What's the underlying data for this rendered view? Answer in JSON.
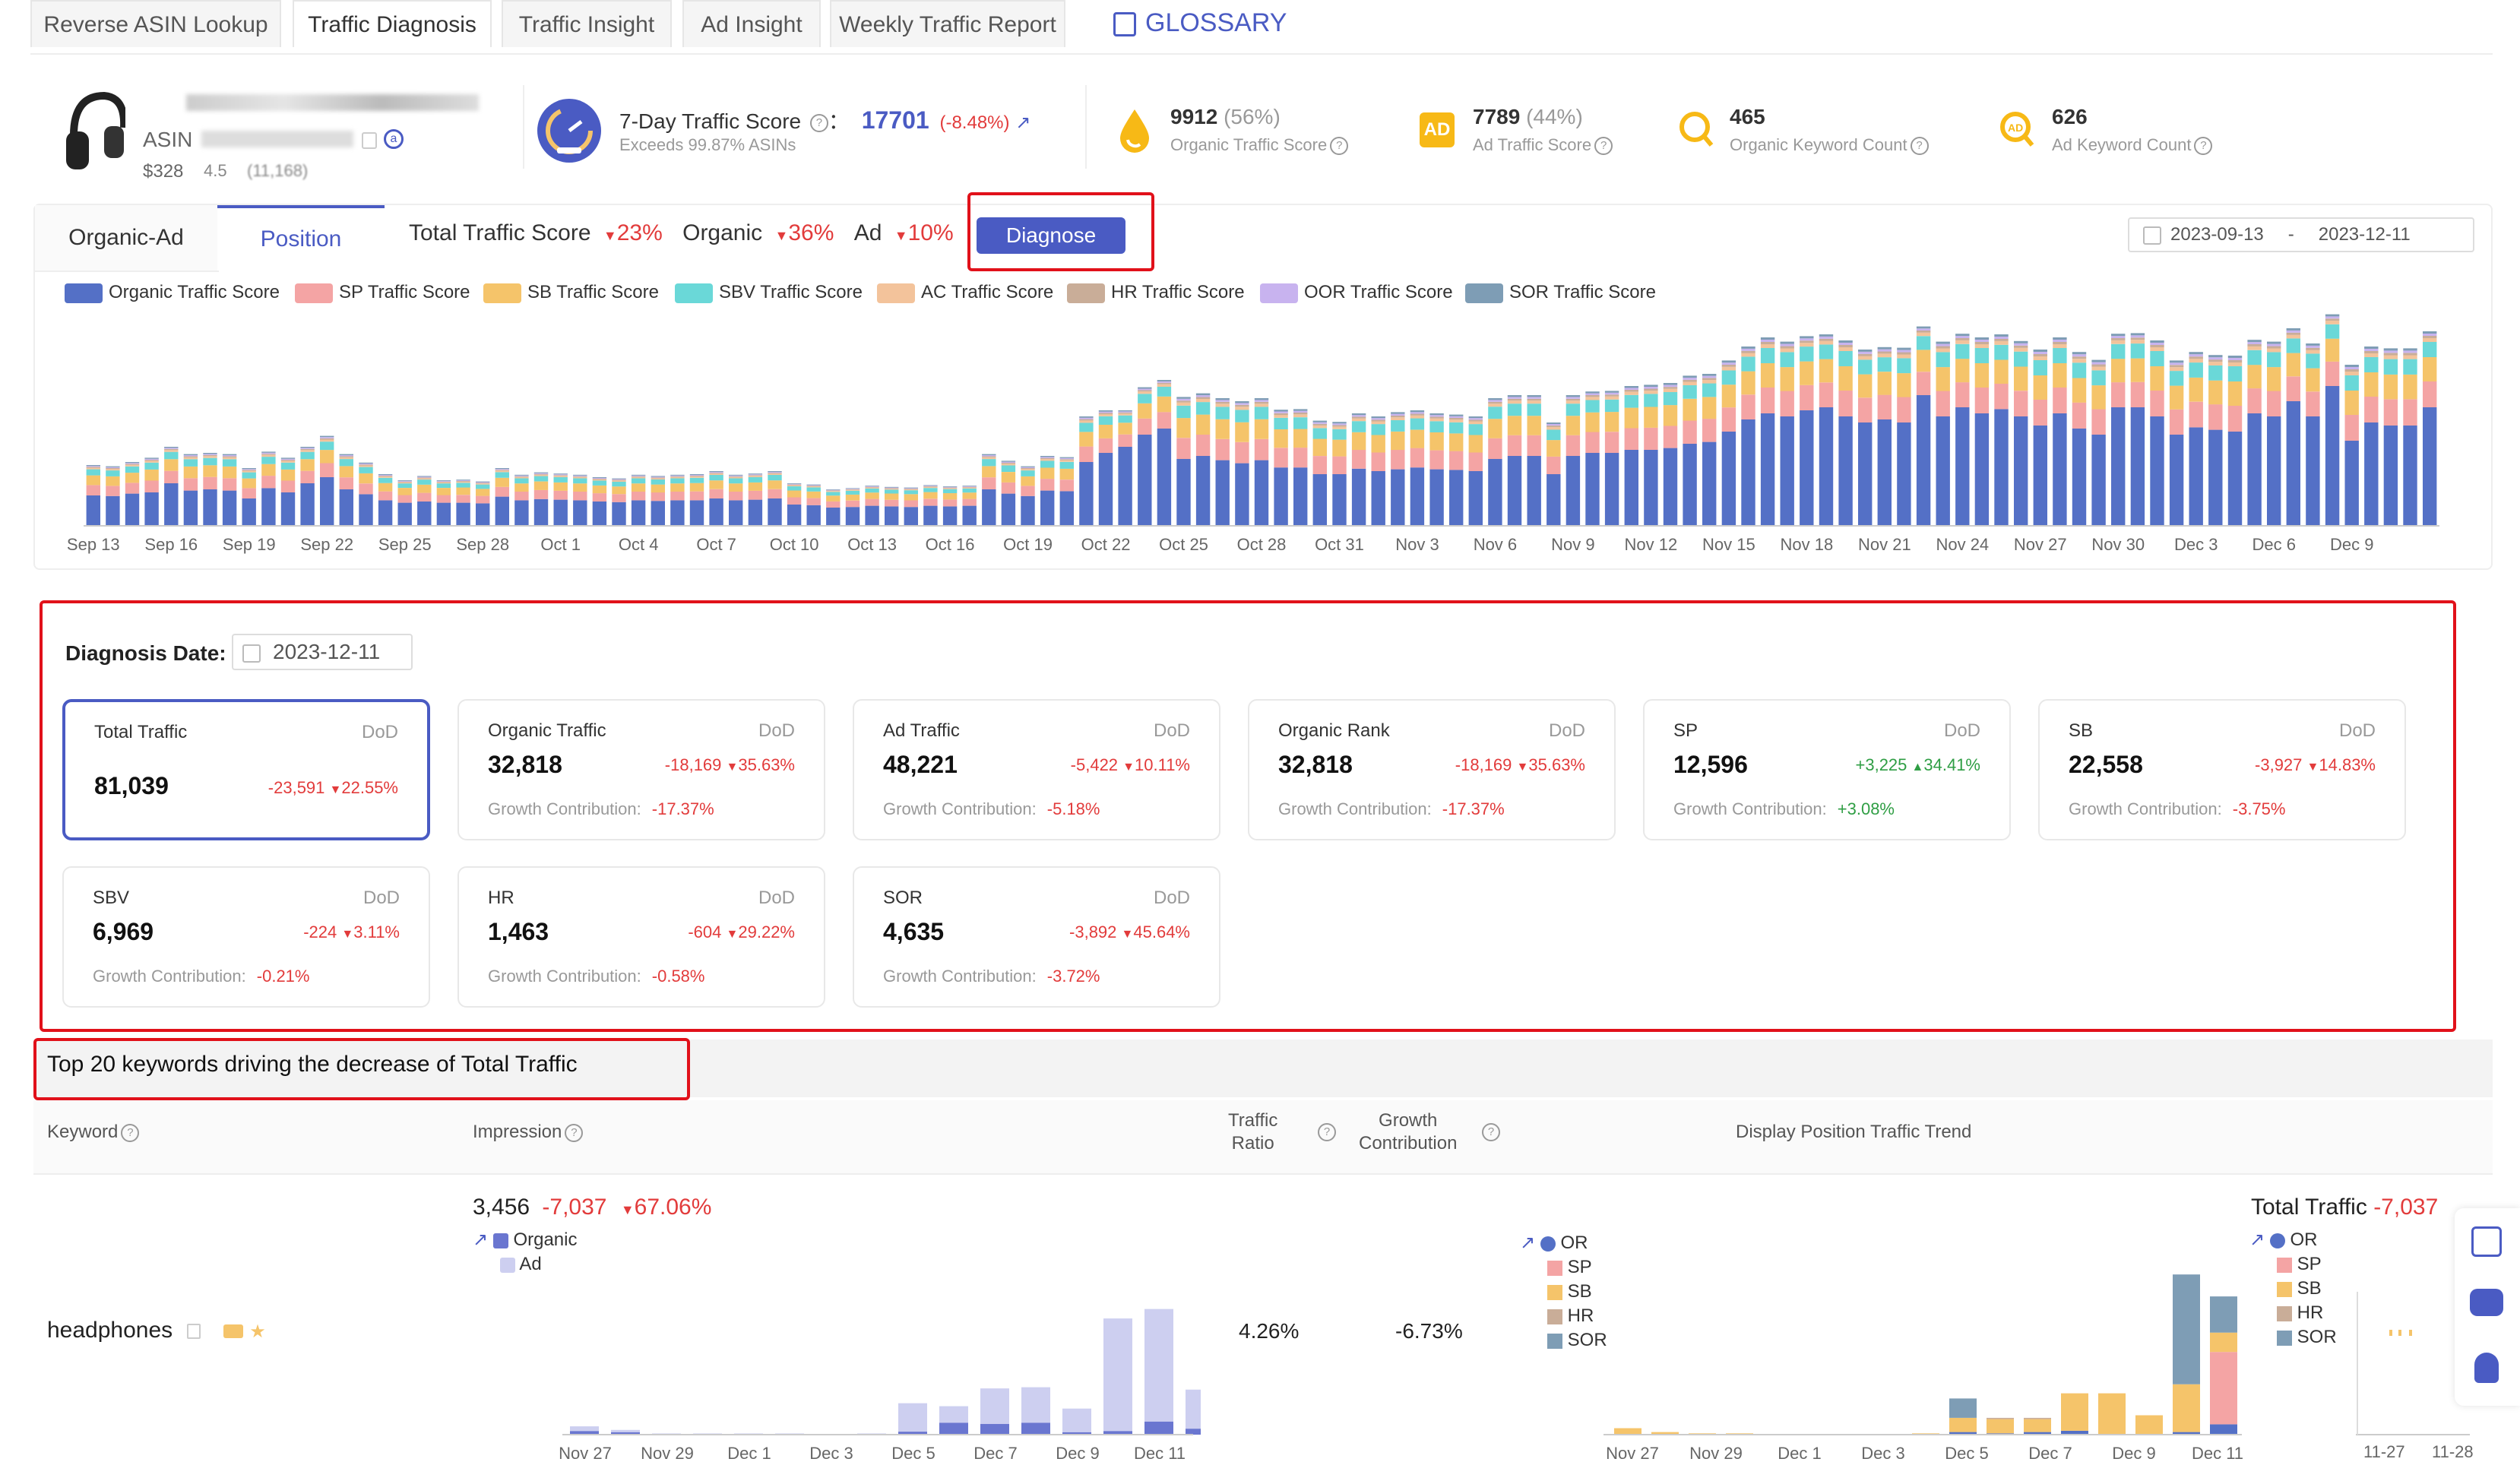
{
  "tabs": [
    "Reverse ASIN Lookup",
    "Traffic Diagnosis",
    "Traffic Insight",
    "Ad Insight",
    "Weekly Traffic Report"
  ],
  "glossary": "GLOSSARY",
  "product": {
    "asin_label": "ASIN",
    "price": "$328",
    "rating": "4.5",
    "reviews": "(11,168)"
  },
  "score": {
    "label": "7-Day Traffic Score",
    "sep": "：",
    "value": "17701",
    "change": "(-8.48%)",
    "sub": "Exceeds 99.87% ASINs"
  },
  "metrics": [
    {
      "value": "9912",
      "pct": "(56%)",
      "label": "Organic Traffic Score"
    },
    {
      "value": "7789",
      "pct": "(44%)",
      "label": "Ad Traffic Score"
    },
    {
      "value": "465",
      "pct": "",
      "label": "Organic Keyword Count"
    },
    {
      "value": "626",
      "pct": "",
      "label": "Ad Keyword Count"
    }
  ],
  "chart_tabs": {
    "a": "Organic-Ad",
    "b": "Position"
  },
  "summary": {
    "total_label": "Total Traffic Score",
    "total": "23%",
    "organic_label": "Organic",
    "organic": "36%",
    "ad_label": "Ad",
    "ad": "10%"
  },
  "diagnose_button": "Diagnose",
  "date_range": {
    "start": "2023-09-13",
    "sep": "-",
    "end": "2023-12-11"
  },
  "legend": [
    {
      "name": "Organic Traffic Score",
      "color": "#5470c6"
    },
    {
      "name": "SP Traffic Score",
      "color": "#f4a4a4"
    },
    {
      "name": "SB Traffic Score",
      "color": "#f5c46a"
    },
    {
      "name": "SBV Traffic Score",
      "color": "#6ad8d8"
    },
    {
      "name": "AC Traffic Score",
      "color": "#f3c39b"
    },
    {
      "name": "HR Traffic Score",
      "color": "#c9ad98"
    },
    {
      "name": "OOR Traffic Score",
      "color": "#c8b3ef"
    },
    {
      "name": "SOR Traffic Score",
      "color": "#7e9db5"
    }
  ],
  "chart_data": {
    "type": "bar",
    "stacked": true,
    "x_tick_labels": [
      "Sep 13",
      "Sep 16",
      "Sep 19",
      "Sep 22",
      "Sep 25",
      "Sep 28",
      "Oct 1",
      "Oct 4",
      "Oct 7",
      "Oct 10",
      "Oct 13",
      "Oct 16",
      "Oct 19",
      "Oct 22",
      "Oct 25",
      "Oct 28",
      "Oct 31",
      "Nov 3",
      "Nov 6",
      "Nov 9",
      "Nov 12",
      "Nov 15",
      "Nov 18",
      "Nov 21",
      "Nov 24",
      "Nov 27",
      "Nov 30",
      "Dec 3",
      "Dec 6",
      "Dec 9"
    ],
    "total_y": [
      100,
      98,
      105,
      112,
      130,
      118,
      120,
      118,
      95,
      122,
      112,
      130,
      148,
      118,
      104,
      85,
      75,
      82,
      75,
      76,
      73,
      95,
      84,
      88,
      86,
      84,
      80,
      78,
      84,
      82,
      84,
      85,
      90,
      84,
      86,
      90,
      70,
      68,
      60,
      62,
      66,
      64,
      63,
      67,
      65,
      66,
      118,
      107,
      98,
      115,
      113,
      180,
      190,
      190,
      228,
      240,
      212,
      218,
      210,
      205,
      210,
      191,
      192,
      173,
      171,
      185,
      180,
      187,
      190,
      185,
      183,
      180,
      210,
      215,
      215,
      170,
      215,
      221,
      222,
      230,
      232,
      235,
      247,
      250,
      272,
      295,
      310,
      303,
      312,
      315,
      305,
      290,
      294,
      293,
      328,
      303,
      316,
      310,
      315,
      304,
      290,
      310,
      286,
      273,
      316,
      317,
      305,
      272,
      286,
      281,
      280,
      306,
      303,
      325,
      300,
      348,
      265,
      295,
      292,
      292,
      320
    ],
    "organic": [
      50,
      49,
      53,
      55,
      70,
      58,
      60,
      58,
      45,
      62,
      55,
      70,
      80,
      60,
      52,
      42,
      38,
      40,
      38,
      38,
      37,
      48,
      42,
      44,
      43,
      42,
      40,
      39,
      42,
      41,
      42,
      42,
      45,
      42,
      43,
      45,
      35,
      34,
      30,
      31,
      33,
      32,
      31,
      33,
      32,
      33,
      60,
      53,
      49,
      58,
      57,
      105,
      120,
      130,
      150,
      160,
      110,
      115,
      108,
      103,
      108,
      96,
      96,
      85,
      85,
      94,
      90,
      93,
      96,
      93,
      92,
      90,
      110,
      115,
      115,
      85,
      115,
      120,
      120,
      125,
      125,
      128,
      135,
      138,
      155,
      175,
      185,
      180,
      190,
      195,
      180,
      170,
      175,
      170,
      215,
      180,
      195,
      185,
      192,
      180,
      165,
      185,
      160,
      150,
      195,
      195,
      180,
      150,
      162,
      158,
      155,
      185,
      180,
      205,
      180,
      230,
      140,
      170,
      165,
      165,
      195
    ],
    "y_max": 350,
    "grid": false
  },
  "diagnosis": {
    "date_label": "Diagnosis Date:",
    "date": "2023-12-11",
    "dod": "DoD",
    "gc_label": "Growth Contribution:",
    "cards": [
      {
        "title": "Total Traffic",
        "value": "81,039",
        "change": "-23,591",
        "arrow": "down",
        "pct": "22.55%",
        "gc": ""
      },
      {
        "title": "Organic Traffic",
        "value": "32,818",
        "change": "-18,169",
        "arrow": "down",
        "pct": "35.63%",
        "gc": "-17.37%"
      },
      {
        "title": "Ad Traffic",
        "value": "48,221",
        "change": "-5,422",
        "arrow": "down",
        "pct": "10.11%",
        "gc": "-5.18%"
      },
      {
        "title": "Organic Rank",
        "value": "32,818",
        "change": "-18,169",
        "arrow": "down",
        "pct": "35.63%",
        "gc": "-17.37%"
      },
      {
        "title": "SP",
        "value": "12,596",
        "change": "+3,225",
        "arrow": "up",
        "pct": "34.41%",
        "gc": "+3.08%"
      },
      {
        "title": "SB",
        "value": "22,558",
        "change": "-3,927",
        "arrow": "down",
        "pct": "14.83%",
        "gc": "-3.75%"
      },
      {
        "title": "SBV",
        "value": "6,969",
        "change": "-224",
        "arrow": "down",
        "pct": "3.11%",
        "gc": "-0.21%"
      },
      {
        "title": "HR",
        "value": "1,463",
        "change": "-604",
        "arrow": "down",
        "pct": "29.22%",
        "gc": "-0.58%"
      },
      {
        "title": "SOR",
        "value": "4,635",
        "change": "-3,892",
        "arrow": "down",
        "pct": "45.64%",
        "gc": "-3.72%"
      }
    ]
  },
  "top_keywords_title": "Top 20 keywords driving the decrease of Total Traffic",
  "table": {
    "headers": {
      "keyword": "Keyword",
      "impression": "Impression",
      "ratio_l1": "Traffic",
      "ratio_l2": "Ratio",
      "growth_l1": "Growth",
      "growth_l2": "Contribution",
      "trend": "Display Position Traffic Trend"
    },
    "row": {
      "keyword": "headphones",
      "imp_value": "3,456",
      "imp_change": "-7,037",
      "imp_pct": "67.06%",
      "imp_legend": [
        "Organic",
        "Ad"
      ],
      "ratio": "4.26%",
      "growth": "-6.73%",
      "pos_legend": [
        "OR",
        "SP",
        "SB",
        "HR",
        "SOR"
      ],
      "total_label": "Total Traffic",
      "total_change": "-7,037",
      "mini_x": [
        "Nov 27",
        "Nov 29",
        "Dec 1",
        "Dec 3",
        "Dec 5",
        "Dec 7",
        "Dec 9",
        "Dec 11"
      ],
      "right_x": [
        "11-27",
        "11-28"
      ]
    }
  }
}
